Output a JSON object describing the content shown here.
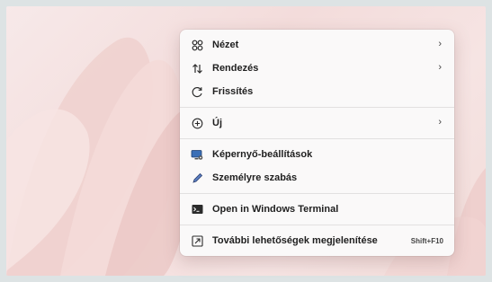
{
  "context_menu": {
    "group1": [
      {
        "label": "Nézet",
        "icon": "view-grid-icon",
        "has_submenu": true
      },
      {
        "label": "Rendezés",
        "icon": "sort-arrows-icon",
        "has_submenu": true
      },
      {
        "label": "Frissítés",
        "icon": "refresh-icon",
        "has_submenu": false
      }
    ],
    "group2": [
      {
        "label": "Új",
        "icon": "new-plus-icon",
        "has_submenu": true
      }
    ],
    "group3": [
      {
        "label": "Képernyő-beállítások",
        "icon": "display-settings-icon"
      },
      {
        "label": "Személyre szabás",
        "icon": "pen-brush-icon"
      }
    ],
    "group4": [
      {
        "label": "Open in Windows Terminal",
        "icon": "terminal-icon"
      }
    ],
    "group5": [
      {
        "label": "További lehetőségek megjelenítése",
        "icon": "more-options-icon",
        "shortcut": "Shift+F10"
      }
    ]
  },
  "colors": {
    "menu_background": "#faf9f9",
    "wallpaper_tint": "#f3dcdb"
  }
}
